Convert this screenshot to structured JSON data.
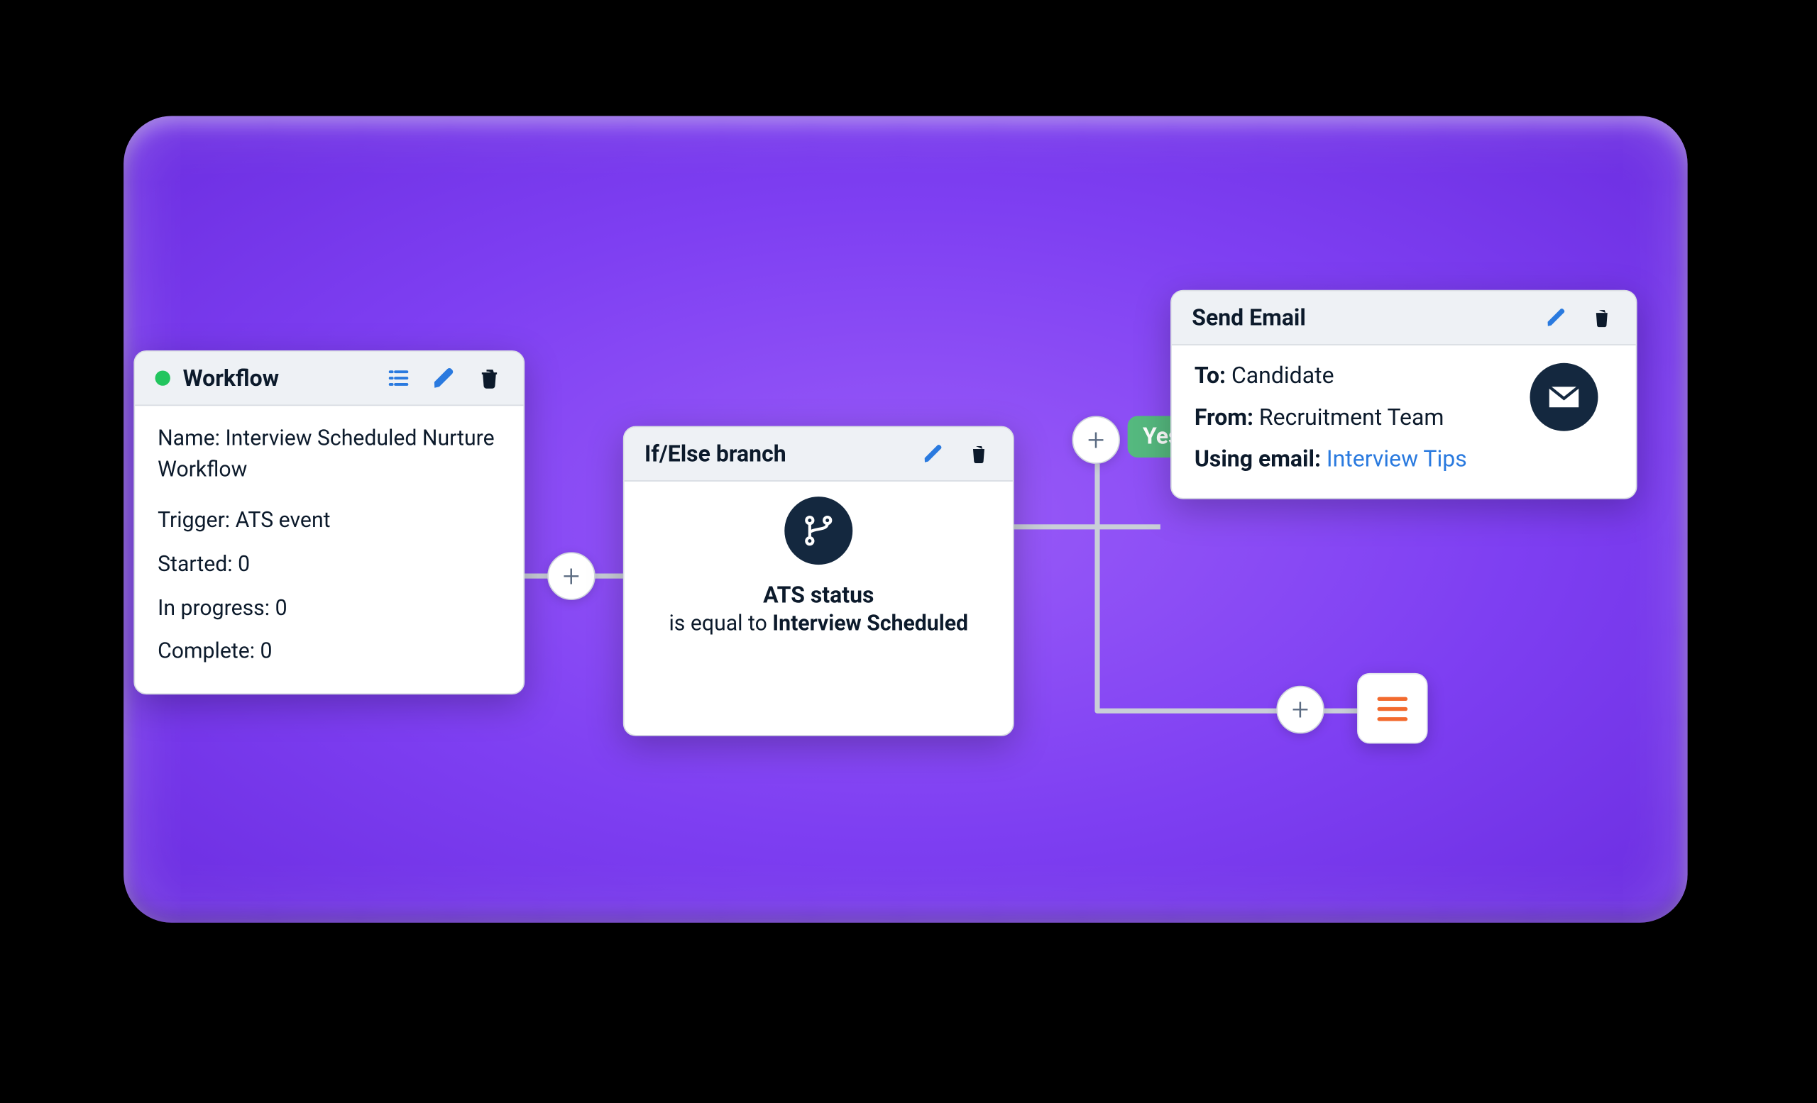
{
  "colors": {
    "panel_gradient_center": "#9a5cf8",
    "panel_gradient_edge": "#6b2de0",
    "accent_blue": "#2a7adf",
    "accent_green": "#22c55e",
    "badge_green": "#55b97f",
    "navy": "#14283f",
    "end_orange": "#f26a2e"
  },
  "workflow_card": {
    "title": "Workflow",
    "status": "active",
    "icons": [
      "list",
      "pencil",
      "trash"
    ],
    "fields": {
      "name_label": "Name:",
      "name_value": "Interview Scheduled Nurture Workflow",
      "trigger_label": "Trigger:",
      "trigger_value": "ATS event",
      "started_label": "Started:",
      "started_value": "0",
      "in_progress_label": "In progress:",
      "in_progress_value": "0",
      "complete_label": "Complete:",
      "complete_value": "0"
    }
  },
  "condition_card": {
    "title": "If/Else branch",
    "icons": [
      "pencil",
      "trash"
    ],
    "icon": "git-branch",
    "line1_field": "ATS status",
    "line2_prefix": "is equal to ",
    "line2_bold": "Interview Scheduled"
  },
  "email_card": {
    "title": "Send Email",
    "icons": [
      "pencil",
      "trash"
    ],
    "icon": "envelope",
    "to_label": "To:",
    "to_value": "Candidate",
    "from_label": "From:",
    "from_value": "Recruitment Team",
    "using_label": "Using email:",
    "using_value": "Interview Tips"
  },
  "branch_badge": "Yes",
  "add_buttons": [
    "after-workflow",
    "before-yes-branch",
    "before-end-node"
  ],
  "end_node_icon": "menu"
}
